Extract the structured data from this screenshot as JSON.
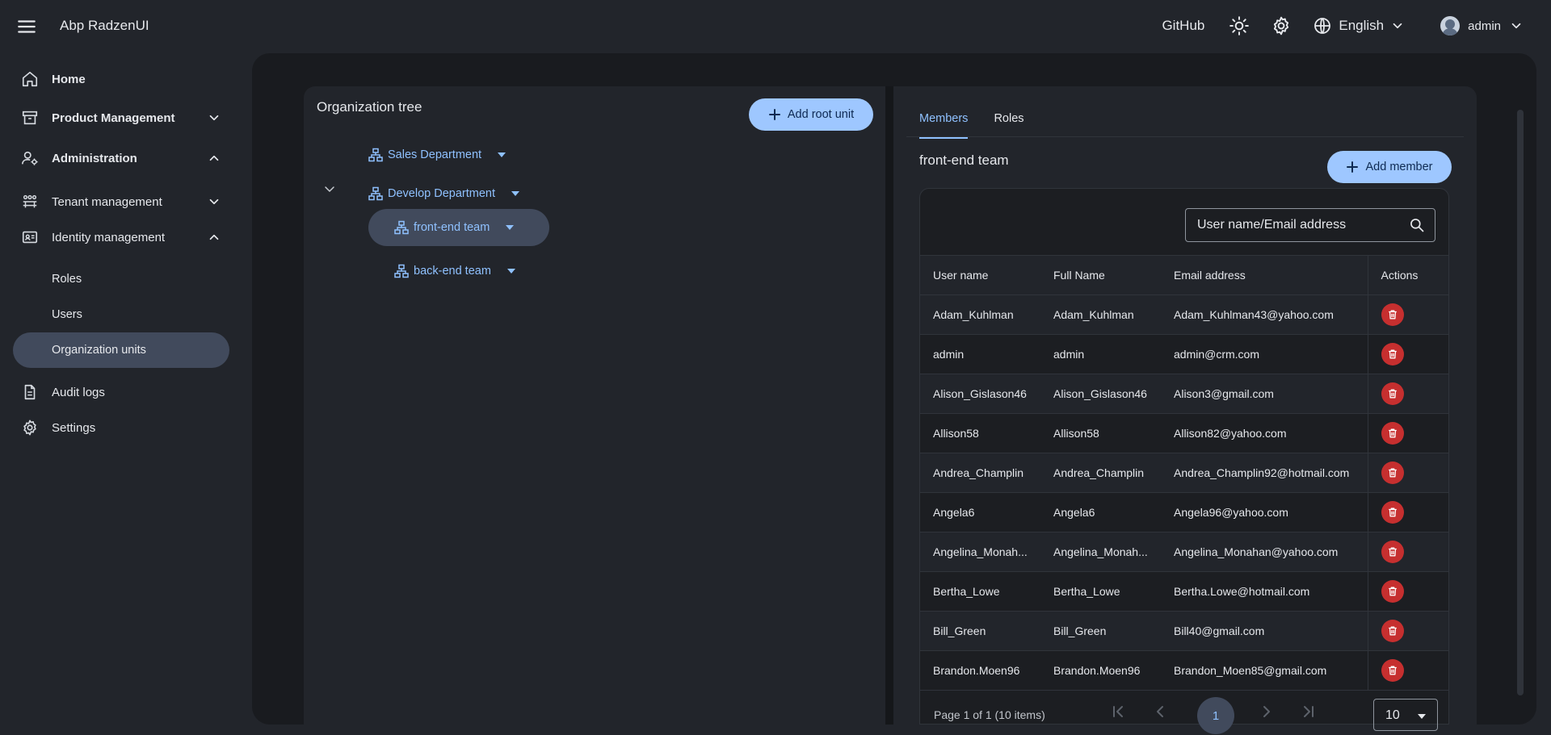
{
  "app": {
    "title": "Abp RadzenUI"
  },
  "topbar": {
    "github_label": "GitHub",
    "language_label": "English",
    "user_label": "admin"
  },
  "sidebar": {
    "items": [
      {
        "label": "Home",
        "icon": "home-icon"
      },
      {
        "label": "Product Management",
        "icon": "archive-icon"
      },
      {
        "label": "Administration",
        "icon": "user-gear-icon"
      },
      {
        "label": "Tenant management",
        "icon": "tenant-icon"
      },
      {
        "label": "Identity management",
        "icon": "id-card-icon"
      },
      {
        "label": "Roles"
      },
      {
        "label": "Users"
      },
      {
        "label": "Organization units"
      },
      {
        "label": "Audit logs",
        "icon": "document-icon"
      },
      {
        "label": "Settings",
        "icon": "gear-icon"
      }
    ]
  },
  "tree": {
    "title": "Organization tree",
    "add_root_label": "Add root unit",
    "nodes": [
      {
        "label": "Sales Department"
      },
      {
        "label": "Develop Department"
      },
      {
        "label": "front-end team"
      },
      {
        "label": "back-end team"
      }
    ]
  },
  "members": {
    "tabs": [
      {
        "label": "Members"
      },
      {
        "label": "Roles"
      }
    ],
    "unit_title": "front-end team",
    "add_member_label": "Add member",
    "search_placeholder": "User name/Email address",
    "columns": [
      "User name",
      "Full Name",
      "Email address",
      "Actions"
    ],
    "rows": [
      {
        "username": "Adam_Kuhlman",
        "fullname": "Adam_Kuhlman",
        "email": "Adam_Kuhlman43@yahoo.com"
      },
      {
        "username": "admin",
        "fullname": "admin",
        "email": "admin@crm.com"
      },
      {
        "username": "Alison_Gislason46",
        "fullname": "Alison_Gislason46",
        "email": "Alison3@gmail.com"
      },
      {
        "username": "Allison58",
        "fullname": "Allison58",
        "email": "Allison82@yahoo.com"
      },
      {
        "username": "Andrea_Champlin",
        "fullname": "Andrea_Champlin",
        "email": "Andrea_Champlin92@hotmail.com"
      },
      {
        "username": "Angela6",
        "fullname": "Angela6",
        "email": "Angela96@yahoo.com"
      },
      {
        "username": "Angelina_Monah...",
        "fullname": "Angelina_Monah...",
        "email": "Angelina_Monahan@yahoo.com"
      },
      {
        "username": "Bertha_Lowe",
        "fullname": "Bertha_Lowe",
        "email": "Bertha.Lowe@hotmail.com"
      },
      {
        "username": "Bill_Green",
        "fullname": "Bill_Green",
        "email": "Bill40@gmail.com"
      },
      {
        "username": "Brandon.Moen96",
        "fullname": "Brandon.Moen96",
        "email": "Brandon_Moen85@gmail.com"
      }
    ],
    "pager": {
      "summary": "Page 1 of 1 (10 items)",
      "current_page": "1",
      "page_size": "10"
    }
  }
}
